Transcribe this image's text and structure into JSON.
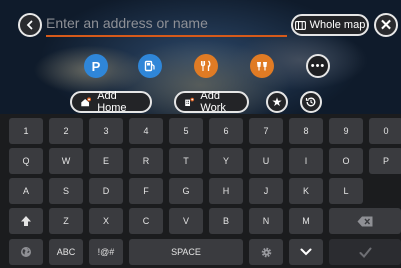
{
  "search": {
    "placeholder": "Enter an address or name",
    "value": ""
  },
  "header": {
    "whole_map_label": "Whole map"
  },
  "categories": [
    {
      "name": "parking",
      "glyph": "P",
      "color": "#2f86d8"
    },
    {
      "name": "fuel",
      "glyph": "⛽",
      "color": "#2f86d8"
    },
    {
      "name": "restaurant",
      "glyph": "🍴",
      "color": "#e07b24"
    },
    {
      "name": "bar",
      "glyph": "🍸",
      "color": "#e07b24"
    }
  ],
  "shortcuts": {
    "add_home": "Add Home",
    "add_work": "Add Work"
  },
  "keyboard": {
    "row1": [
      "1",
      "2",
      "3",
      "4",
      "5",
      "6",
      "7",
      "8",
      "9",
      "0"
    ],
    "row2": [
      "Q",
      "W",
      "E",
      "R",
      "T",
      "Y",
      "U",
      "I",
      "O",
      "P"
    ],
    "row3": [
      "A",
      "S",
      "D",
      "F",
      "G",
      "H",
      "J",
      "K",
      "L"
    ],
    "row4": [
      "Z",
      "X",
      "C",
      "V",
      "B",
      "N",
      "M"
    ],
    "abc": "ABC",
    "symbols": "!@#",
    "space": "SPACE"
  },
  "colors": {
    "accent": "#d65a1a",
    "poi_blue": "#2f86d8",
    "poi_orange": "#e07b24"
  }
}
